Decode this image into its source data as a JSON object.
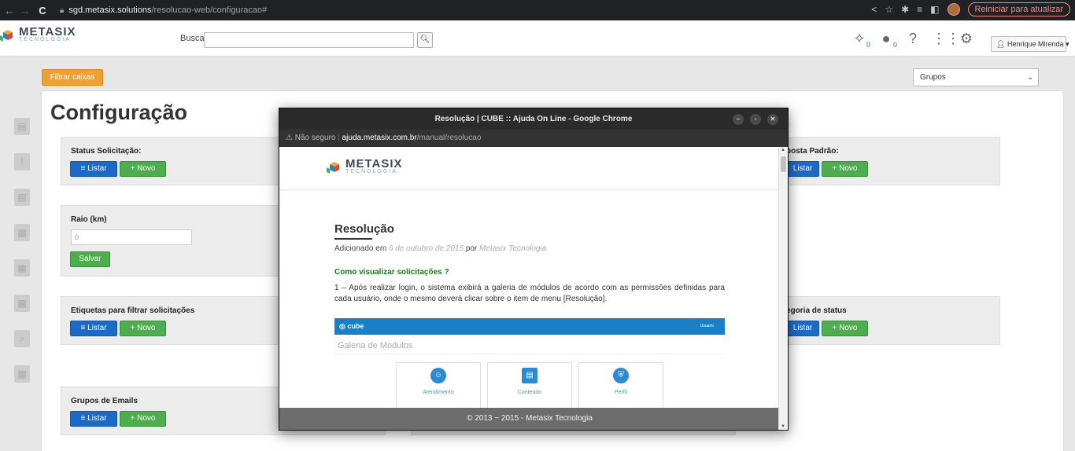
{
  "browser": {
    "url_host": "sgd.metasix.solutions",
    "url_path": "/resolucao-web/configuracao#",
    "update_button": "Reiniciar para atualizar"
  },
  "header": {
    "logo_title": "METASIX",
    "logo_subtitle": "TECNOLOGIA",
    "search_label": "Busca:",
    "search_value": "",
    "notif_count_1": "0",
    "notif_count_2": "0",
    "user_name": "Henrique Mirenda"
  },
  "toolbar": {
    "filter_button": "Filtrar caixas",
    "groups_select": "Grupos"
  },
  "page": {
    "title": "Configuração",
    "sections": {
      "status": {
        "label": "Status Solicitação:",
        "list": "Listar",
        "new": "Novo"
      },
      "raio": {
        "label": "Raio (km)",
        "value": "0",
        "save": "Salvar"
      },
      "etiquetas": {
        "label": "Etiquetas para filtrar solicitações",
        "list": "Listar",
        "new": "Novo"
      },
      "grupos_emails": {
        "label": "Grupos de Emails",
        "list": "Listar",
        "new": "Novo"
      },
      "resposta": {
        "label": "posta Padrão:",
        "list": "Listar",
        "new": "Novo"
      },
      "categoria": {
        "label": "egoria de status",
        "list": "Listar",
        "new": "Novo"
      }
    }
  },
  "popup": {
    "window_title": "Resolução | CUBE :: Ajuda On Line - Google Chrome",
    "not_secure": "Não seguro",
    "url_host": "ajuda.metasix.com.br",
    "url_path": "/manual/resolucao",
    "article": {
      "title": "Resolução",
      "added_prefix": "Adicionado em",
      "date": "6 de outubro de 2015",
      "by": "por",
      "author": "Metasix Tecnologia",
      "heading": "Como visualizar solicitações ?",
      "paragraph": "1 – Após realizar login, o sistema exibirá a galeria de módulos de acordo com as permissões definidas para cada usuário, onde o mesmo deverá clicar sobre o item de menu [Resolução].",
      "screenshot": {
        "brand": "cube",
        "user": "Usuario",
        "gallery": "Galeria de Modulos",
        "modules": [
          "Atendimento",
          "Conteúdo",
          "Perfil"
        ]
      }
    },
    "footer": "© 2013 ~ 2015 - Metasix Tecnologia"
  }
}
